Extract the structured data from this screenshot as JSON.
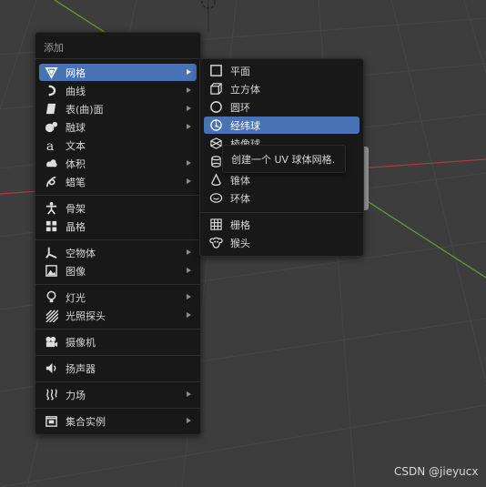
{
  "add_menu": {
    "title": "添加",
    "items": [
      {
        "label": "网格",
        "icon": "mesh-icon",
        "submenu": true,
        "active": true
      },
      {
        "label": "曲线",
        "icon": "curve-icon",
        "submenu": true
      },
      {
        "label": "表(曲)面",
        "icon": "surface-icon",
        "submenu": true
      },
      {
        "label": "融球",
        "icon": "metaball-icon",
        "submenu": true
      },
      {
        "label": "文本",
        "icon": "text-icon",
        "submenu": false
      },
      {
        "label": "体积",
        "icon": "volume-icon",
        "submenu": true
      },
      {
        "label": "蜡笔",
        "icon": "grease-pencil-icon",
        "submenu": true
      },
      {
        "label": "骨架",
        "icon": "armature-icon",
        "submenu": false
      },
      {
        "label": "晶格",
        "icon": "lattice-icon",
        "submenu": false
      },
      {
        "label": "空物体",
        "icon": "empty-icon",
        "submenu": true
      },
      {
        "label": "图像",
        "icon": "image-icon",
        "submenu": true
      },
      {
        "label": "灯光",
        "icon": "light-icon",
        "submenu": true
      },
      {
        "label": "光照探头",
        "icon": "light-probe-icon",
        "submenu": true
      },
      {
        "label": "摄像机",
        "icon": "camera-icon",
        "submenu": false
      },
      {
        "label": "扬声器",
        "icon": "speaker-icon",
        "submenu": false
      },
      {
        "label": "力场",
        "icon": "force-field-icon",
        "submenu": true
      },
      {
        "label": "集合实例",
        "icon": "collection-instance-icon",
        "submenu": true
      }
    ]
  },
  "mesh_submenu": {
    "items": [
      {
        "label": "平面",
        "icon": "plane-icon"
      },
      {
        "label": "立方体",
        "icon": "cube-icon"
      },
      {
        "label": "圆环",
        "icon": "circle-icon"
      },
      {
        "label": "经纬球",
        "icon": "uv-sphere-icon",
        "active": true
      },
      {
        "label": "棱像球",
        "icon": "ico-sphere-icon"
      },
      {
        "label": "",
        "icon": "cylinder-icon"
      },
      {
        "label": "锥体",
        "icon": "cone-icon"
      },
      {
        "label": "环体",
        "icon": "torus-icon"
      },
      {
        "label": "栅格",
        "icon": "grid-icon"
      },
      {
        "label": "猴头",
        "icon": "monkey-icon"
      }
    ]
  },
  "tooltip": {
    "text": "创建一个 UV 球体网格."
  },
  "watermark": "CSDN @jieyucx",
  "colors": {
    "background": "#3d3d3d",
    "menu": "#181818",
    "highlight": "#4772b3",
    "x_axis": "#a83a3a",
    "y_axis": "#6c9a2e"
  }
}
